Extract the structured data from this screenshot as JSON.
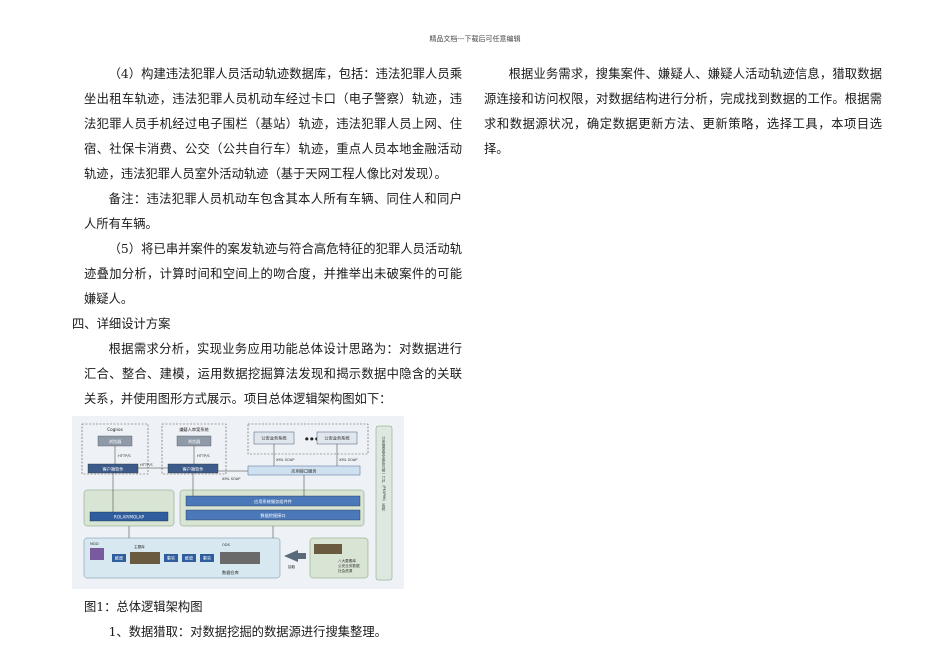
{
  "header": {
    "text": "精品文档---下载后可任意编辑"
  },
  "left_column": {
    "para1": "（4）构建违法犯罪人员活动轨迹数据库，包括：违法犯罪人员乘坐出租车轨迹，违法犯罪人员机动车经过卡口（电子警察）轨迹，违法犯罪人员手机经过电子围栏（基站）轨迹，违法犯罪人员上网、住宿、社保卡消费、公交（公共自行车）轨迹，重点人员本地金融活动轨迹，违法犯罪人员室外活动轨迹（基于天网工程人像比对发现）。",
    "para2": "备注：违法犯罪人员机动车包含其本人所有车辆、同住人和同户人所有车辆。",
    "para3": "（5）将已串并案件的案发轨迹与符合高危特征的犯罪人员活动轨迹叠加分析，计算时间和空间上的吻合度，并推举出未破案件的可能嫌疑人。",
    "heading4": "四、详细设计方案",
    "para4": "根据需求分析，实现业务应用功能总体设计思路为：对数据进行汇合、整合、建模，运用数据挖掘算法发现和揭示数据中隐含的关联关系，并使用图形方式展示。项目总体逻辑架构图如下：",
    "caption": "图1：总体逻辑架构图",
    "para5": "1、数据猎取：对数据挖掘的数据源进行搜集整理。"
  },
  "right_column": {
    "para1": "根据业务需求，搜集案件、嫌疑人、嫌疑人活动轨迹信息，猎取数据源连接和访问权限，对数据结构进行分析，完成找到数据的工作。根据需求和数据源状况，确定数据更新方法、更新策略，选择工具，本项目选择。"
  },
  "diagram": {
    "cognos_title": "Cognos",
    "browser1": "浏览器",
    "browser2": "浏览器",
    "suspect_system": "嫌疑人串案系统",
    "client1": "客户端软件",
    "client2": "客户端软件",
    "http1": "HTTP/S",
    "http2": "HTTP/S",
    "http3": "HTTP/S",
    "police_system1": "公安业务系统",
    "police_system2": "公安业务系统",
    "xml_soap1": "XML SOAP",
    "xml_soap2": "XML SOAP",
    "xml_soap3": "XML SOAP",
    "app_interface": "应用接口服务",
    "app_system_service": "应用系统服务组件件",
    "data_mining_interface": "数据挖掘接口",
    "rolap": "ROLAP/MOLAP",
    "data_warehouse": "数据仓库",
    "ods": "ODS",
    "mdd": "MDD",
    "dw_label": "主题库\nDW 人/案/物/组",
    "dims": [
      "维度",
      "事实",
      "维度",
      "事实"
    ],
    "etl": "抽取",
    "sources": "八大要素库\n公安业务数据\n社会资源",
    "side_label": "公安信息安全体系与统一门户（PKI/PMI）系统"
  }
}
